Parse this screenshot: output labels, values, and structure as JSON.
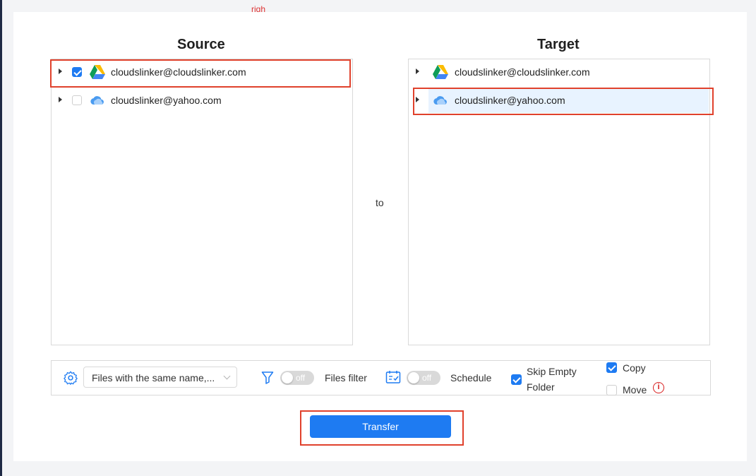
{
  "top_note": "righ",
  "source": {
    "title": "Source",
    "items": [
      {
        "label": "cloudslinker@cloudslinker.com",
        "checked": true,
        "icon": "google-drive-icon"
      },
      {
        "label": "cloudslinker@yahoo.com",
        "checked": false,
        "icon": "cloud-icon"
      }
    ]
  },
  "connector": "to",
  "target": {
    "title": "Target",
    "items": [
      {
        "label": "cloudslinker@cloudslinker.com",
        "icon": "google-drive-icon"
      },
      {
        "label": "cloudslinker@yahoo.com",
        "icon": "cloud-icon",
        "selected": true
      }
    ]
  },
  "options": {
    "conflict_select": "Files with the same name,...",
    "toggle_off": "off",
    "files_filter": "Files filter",
    "schedule": "Schedule",
    "skip_empty_line1": "Skip Empty",
    "skip_empty_line2": "Folder",
    "skip_empty_checked": true,
    "copy": "Copy",
    "copy_checked": true,
    "move": "Move",
    "move_checked": false,
    "info_glyph": "i"
  },
  "transfer_button": "Transfer",
  "colors": {
    "accent": "#1e7bf2",
    "highlight": "#e8f3ff",
    "annotation_red": "#e0412c"
  }
}
